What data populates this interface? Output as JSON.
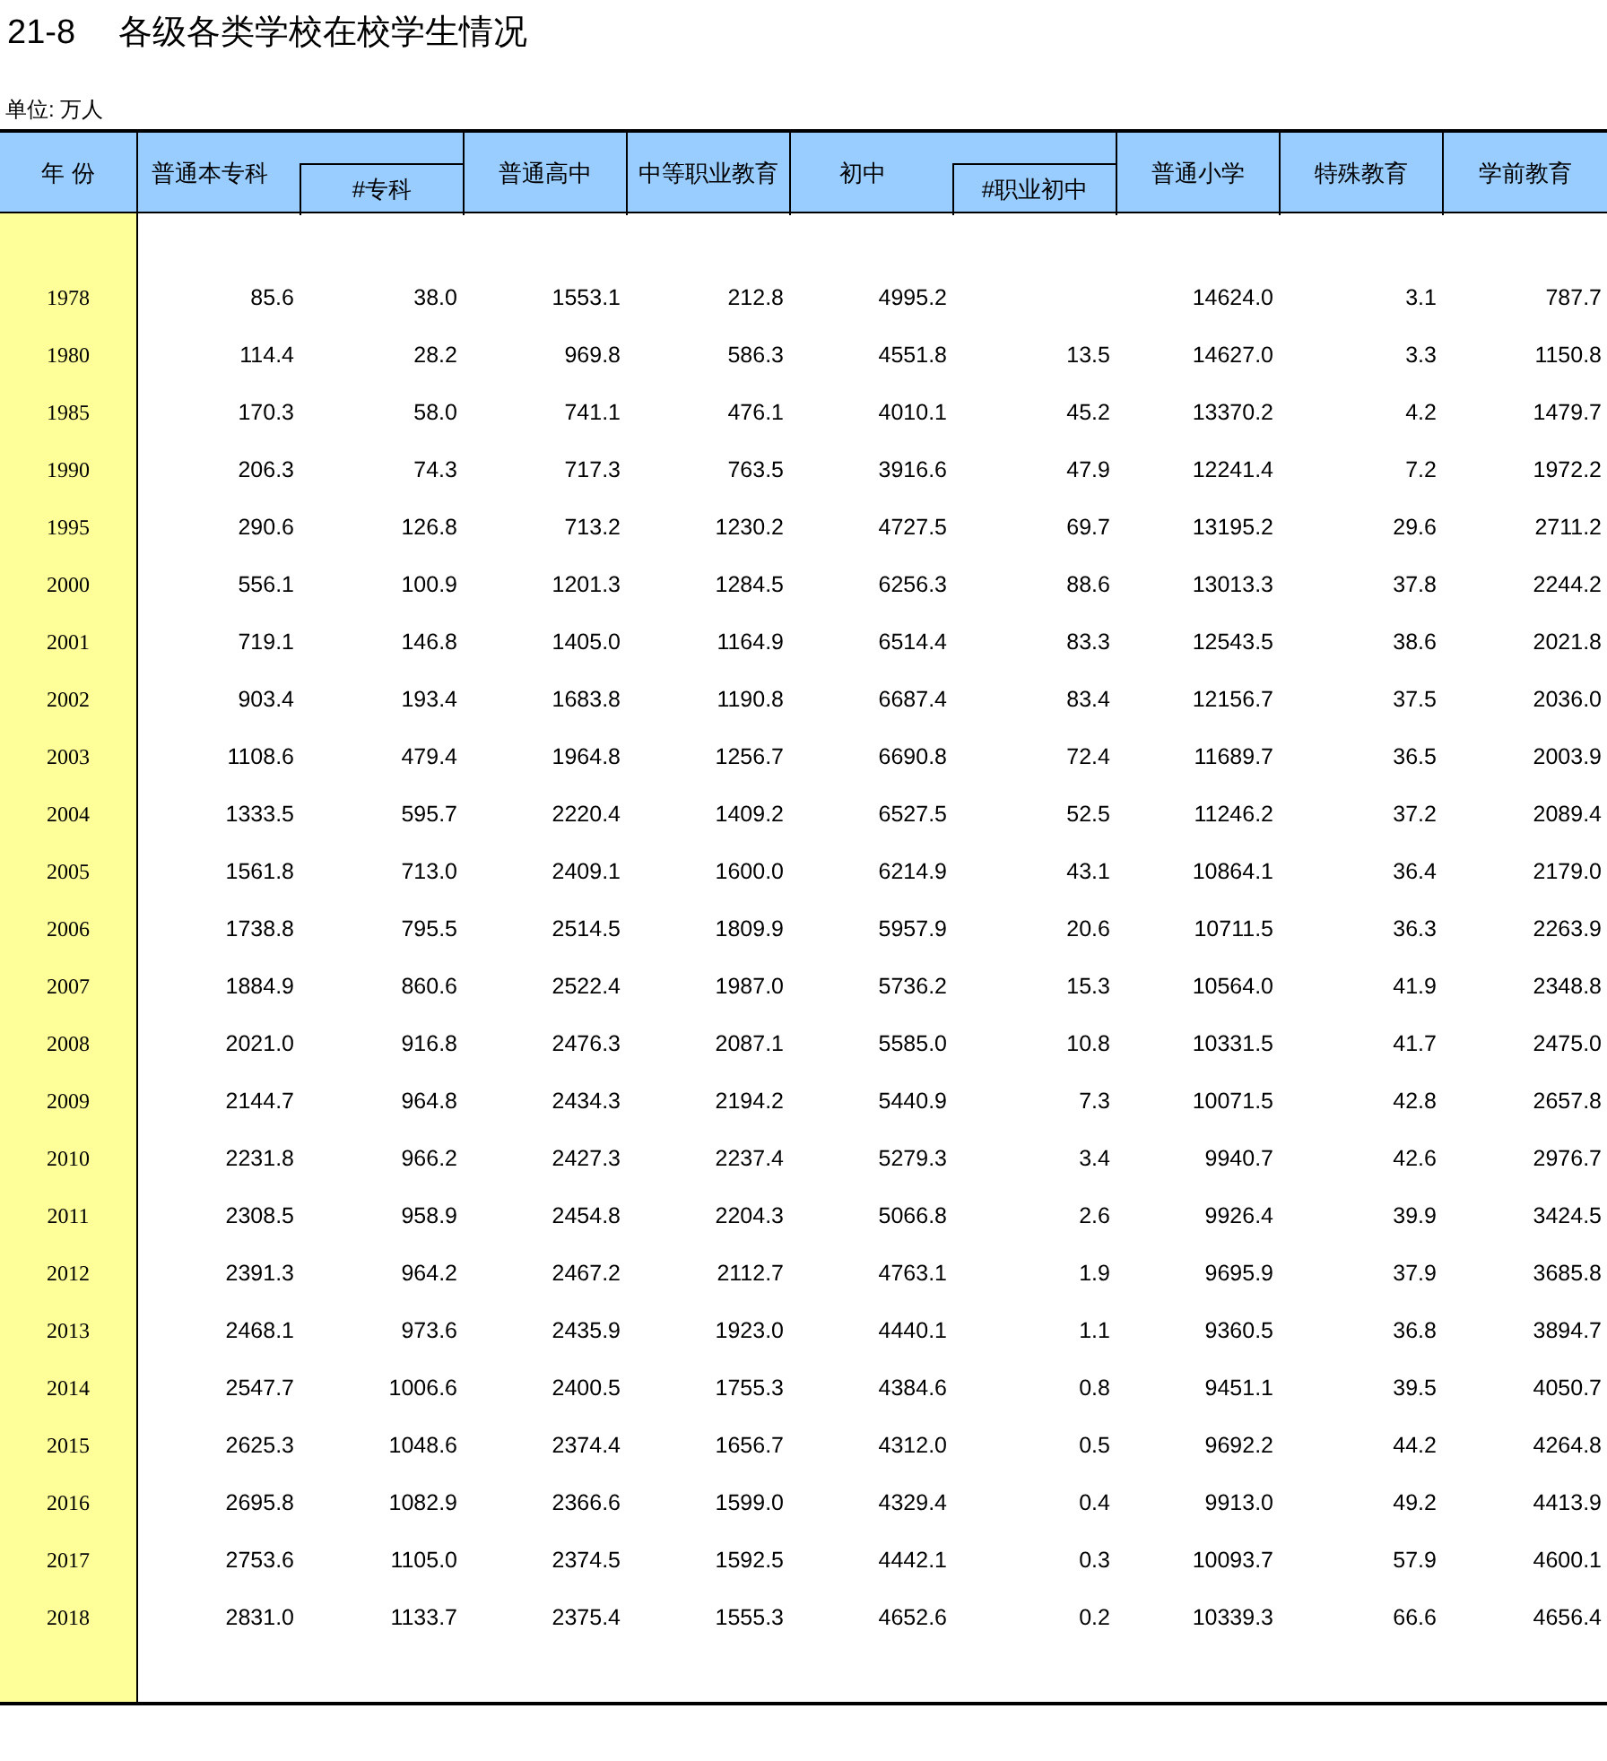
{
  "title": {
    "number": "21-8",
    "text": "各级各类学校在校学生情况"
  },
  "unit": "单位: 万人",
  "columns": [
    {
      "label": "年 份",
      "kind": "full"
    },
    {
      "label": "普通本专科",
      "kind": "group"
    },
    {
      "label": "#专科",
      "kind": "sub"
    },
    {
      "label": "普通高中",
      "kind": "full"
    },
    {
      "label": "中等职业教育",
      "kind": "full"
    },
    {
      "label": "初中",
      "kind": "group"
    },
    {
      "label": "#职业初中",
      "kind": "sub"
    },
    {
      "label": "普通小学",
      "kind": "full"
    },
    {
      "label": "特殊教育",
      "kind": "full"
    },
    {
      "label": "学前教育",
      "kind": "full"
    }
  ],
  "rows": [
    {
      "year": "1978",
      "undergrad": "85.6",
      "junior_college": "38.0",
      "senior_high": "1553.1",
      "vocational": "212.8",
      "junior_high": "4995.2",
      "primary": "14624.0",
      "special": "3.1",
      "preschool": "787.7"
    },
    {
      "year": "1980",
      "undergrad": "114.4",
      "junior_college": "28.2",
      "senior_high": "969.8",
      "vocational": "586.3",
      "junior_high": "4551.8",
      "vocational_junior": "13.5",
      "primary": "14627.0",
      "special": "3.3",
      "preschool": "1150.8"
    },
    {
      "year": "1985",
      "undergrad": "170.3",
      "junior_college": "58.0",
      "senior_high": "741.1",
      "vocational": "476.1",
      "junior_high": "4010.1",
      "vocational_junior": "45.2",
      "primary": "13370.2",
      "special": "4.2",
      "preschool": "1479.7"
    },
    {
      "year": "1990",
      "undergrad": "206.3",
      "junior_college": "74.3",
      "senior_high": "717.3",
      "vocational": "763.5",
      "junior_high": "3916.6",
      "vocational_junior": "47.9",
      "primary": "12241.4",
      "special": "7.2",
      "preschool": "1972.2"
    },
    {
      "year": "1995",
      "undergrad": "290.6",
      "junior_college": "126.8",
      "senior_high": "713.2",
      "vocational": "1230.2",
      "junior_high": "4727.5",
      "vocational_junior": "69.7",
      "primary": "13195.2",
      "special": "29.6",
      "preschool": "2711.2"
    },
    {
      "year": "2000",
      "undergrad": "556.1",
      "junior_college": "100.9",
      "senior_high": "1201.3",
      "vocational": "1284.5",
      "junior_high": "6256.3",
      "vocational_junior": "88.6",
      "primary": "13013.3",
      "special": "37.8",
      "preschool": "2244.2"
    },
    {
      "year": "2001",
      "undergrad": "719.1",
      "junior_college": "146.8",
      "senior_high": "1405.0",
      "vocational": "1164.9",
      "junior_high": "6514.4",
      "vocational_junior": "83.3",
      "primary": "12543.5",
      "special": "38.6",
      "preschool": "2021.8"
    },
    {
      "year": "2002",
      "undergrad": "903.4",
      "junior_college": "193.4",
      "senior_high": "1683.8",
      "vocational": "1190.8",
      "junior_high": "6687.4",
      "vocational_junior": "83.4",
      "primary": "12156.7",
      "special": "37.5",
      "preschool": "2036.0"
    },
    {
      "year": "2003",
      "undergrad": "1108.6",
      "junior_college": "479.4",
      "senior_high": "1964.8",
      "vocational": "1256.7",
      "junior_high": "6690.8",
      "vocational_junior": "72.4",
      "primary": "11689.7",
      "special": "36.5",
      "preschool": "2003.9"
    },
    {
      "year": "2004",
      "undergrad": "1333.5",
      "junior_college": "595.7",
      "senior_high": "2220.4",
      "vocational": "1409.2",
      "junior_high": "6527.5",
      "vocational_junior": "52.5",
      "primary": "11246.2",
      "special": "37.2",
      "preschool": "2089.4"
    },
    {
      "year": "2005",
      "undergrad": "1561.8",
      "junior_college": "713.0",
      "senior_high": "2409.1",
      "vocational": "1600.0",
      "junior_high": "6214.9",
      "vocational_junior": "43.1",
      "primary": "10864.1",
      "special": "36.4",
      "preschool": "2179.0"
    },
    {
      "year": "2006",
      "undergrad": "1738.8",
      "junior_college": "795.5",
      "senior_high": "2514.5",
      "vocational": "1809.9",
      "junior_high": "5957.9",
      "vocational_junior": "20.6",
      "primary": "10711.5",
      "special": "36.3",
      "preschool": "2263.9"
    },
    {
      "year": "2007",
      "undergrad": "1884.9",
      "junior_college": "860.6",
      "senior_high": "2522.4",
      "vocational": "1987.0",
      "junior_high": "5736.2",
      "vocational_junior": "15.3",
      "primary": "10564.0",
      "special": "41.9",
      "preschool": "2348.8"
    },
    {
      "year": "2008",
      "undergrad": "2021.0",
      "junior_college": "916.8",
      "senior_high": "2476.3",
      "vocational": "2087.1",
      "junior_high": "5585.0",
      "vocational_junior": "10.8",
      "primary": "10331.5",
      "special": "41.7",
      "preschool": "2475.0"
    },
    {
      "year": "2009",
      "undergrad": "2144.7",
      "junior_college": "964.8",
      "senior_high": "2434.3",
      "vocational": "2194.2",
      "junior_high": "5440.9",
      "vocational_junior": "7.3",
      "primary": "10071.5",
      "special": "42.8",
      "preschool": "2657.8"
    },
    {
      "year": "2010",
      "undergrad": "2231.8",
      "junior_college": "966.2",
      "senior_high": "2427.3",
      "vocational": "2237.4",
      "junior_high": "5279.3",
      "vocational_junior": "3.4",
      "primary": "9940.7",
      "special": "42.6",
      "preschool": "2976.7"
    },
    {
      "year": "2011",
      "undergrad": "2308.5",
      "junior_college": "958.9",
      "senior_high": "2454.8",
      "vocational": "2204.3",
      "junior_high": "5066.8",
      "vocational_junior": "2.6",
      "primary": "9926.4",
      "special": "39.9",
      "preschool": "3424.5"
    },
    {
      "year": "2012",
      "undergrad": "2391.3",
      "junior_college": "964.2",
      "senior_high": "2467.2",
      "vocational": "2112.7",
      "junior_high": "4763.1",
      "vocational_junior": "1.9",
      "primary": "9695.9",
      "special": "37.9",
      "preschool": "3685.8"
    },
    {
      "year": "2013",
      "undergrad": "2468.1",
      "junior_college": "973.6",
      "senior_high": "2435.9",
      "vocational": "1923.0",
      "junior_high": "4440.1",
      "vocational_junior": "1.1",
      "primary": "9360.5",
      "special": "36.8",
      "preschool": "3894.7"
    },
    {
      "year": "2014",
      "undergrad": "2547.7",
      "junior_college": "1006.6",
      "senior_high": "2400.5",
      "vocational": "1755.3",
      "junior_high": "4384.6",
      "vocational_junior": "0.8",
      "primary": "9451.1",
      "special": "39.5",
      "preschool": "4050.7"
    },
    {
      "year": "2015",
      "undergrad": "2625.3",
      "junior_college": "1048.6",
      "senior_high": "2374.4",
      "vocational": "1656.7",
      "junior_high": "4312.0",
      "vocational_junior": "0.5",
      "primary": "9692.2",
      "special": "44.2",
      "preschool": "4264.8"
    },
    {
      "year": "2016",
      "undergrad": "2695.8",
      "junior_college": "1082.9",
      "senior_high": "2366.6",
      "vocational": "1599.0",
      "junior_high": "4329.4",
      "vocational_junior": "0.4",
      "primary": "9913.0",
      "special": "49.2",
      "preschool": "4413.9"
    },
    {
      "year": "2017",
      "undergrad": "2753.6",
      "junior_college": "1105.0",
      "senior_high": "2374.5",
      "vocational": "1592.5",
      "junior_high": "4442.1",
      "vocational_junior": "0.3",
      "primary": "10093.7",
      "special": "57.9",
      "preschool": "4600.1"
    },
    {
      "year": "2018",
      "undergrad": "2831.0",
      "junior_college": "1133.7",
      "senior_high": "2375.4",
      "vocational": "1555.3",
      "junior_high": "4652.6",
      "vocational_junior": "0.2",
      "primary": "10339.3",
      "special": "66.6",
      "preschool": "4656.4"
    }
  ]
}
